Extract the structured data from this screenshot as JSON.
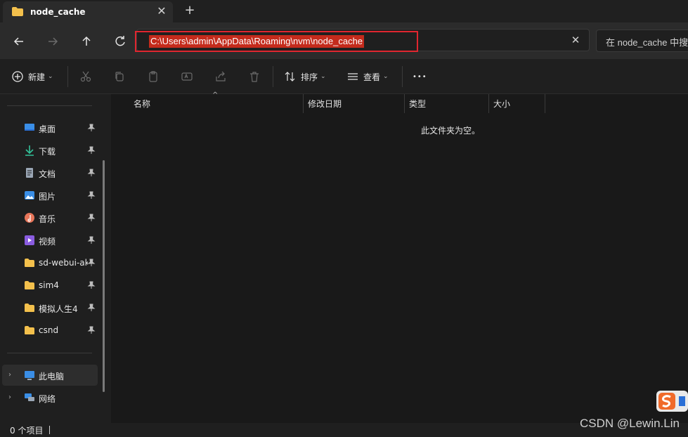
{
  "tab": {
    "title": "node_cache",
    "close_glyph": "✕",
    "new_tab_glyph": "+"
  },
  "address": {
    "path": "C:\\Users\\admin\\AppData\\Roaming\\nvm\\node_cache",
    "clear_glyph": "✕"
  },
  "search": {
    "placeholder": "在 node_cache 中搜"
  },
  "toolbar": {
    "new_label": "新建",
    "sort_label": "排序",
    "view_label": "查看",
    "more_glyph": "•••",
    "caret": "⌄"
  },
  "sidebar": {
    "quick_access": [
      {
        "label": "桌面",
        "icon": "desktop-icon",
        "color": "#3a8ee6"
      },
      {
        "label": "下载",
        "icon": "download-icon",
        "color": "#32c29a"
      },
      {
        "label": "文档",
        "icon": "document-icon",
        "color": "#9aa6b5"
      },
      {
        "label": "图片",
        "icon": "pictures-icon",
        "color": "#3a8ee6"
      },
      {
        "label": "音乐",
        "icon": "music-icon",
        "color": "#e8765a"
      },
      {
        "label": "视频",
        "icon": "video-icon",
        "color": "#8a5ce0"
      },
      {
        "label": "sd-webui-aki",
        "icon": "folder-icon",
        "color": "#f3c04c"
      },
      {
        "label": "sim4",
        "icon": "folder-icon",
        "color": "#f3c04c"
      },
      {
        "label": "模拟人生4",
        "icon": "folder-icon",
        "color": "#f3c04c"
      },
      {
        "label": "csnd",
        "icon": "folder-icon",
        "color": "#f3c04c"
      }
    ],
    "this_pc": "此电脑",
    "network": "网络",
    "chevron": "›"
  },
  "columns": {
    "name": "名称",
    "modified": "修改日期",
    "type": "类型",
    "size": "大小",
    "sort_glyph": "^"
  },
  "content": {
    "empty_message": "此文件夹为空。"
  },
  "status": {
    "item_count": "0 个项目"
  },
  "watermark": {
    "text": "CSDN @Lewin.Lin"
  },
  "colors": {
    "accent_red": "#e0262f",
    "selection": "#c42b1c",
    "folder": "#f3c04c"
  }
}
